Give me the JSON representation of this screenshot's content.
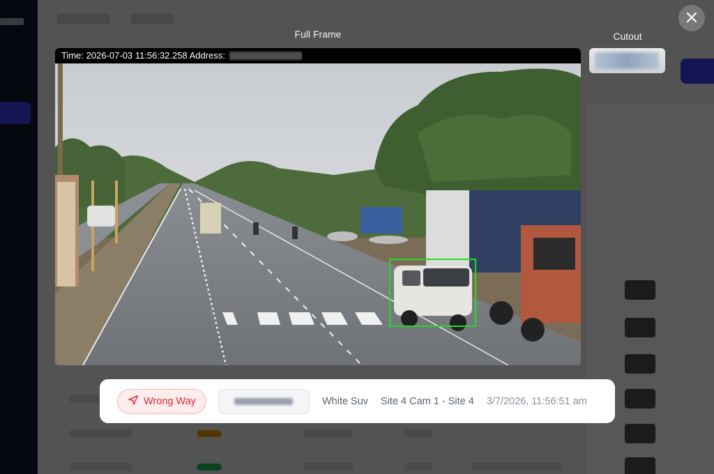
{
  "modal": {
    "full_frame_title": "Full Frame",
    "cutout_title": "Cutout",
    "frame_header": {
      "time_label": "Time:",
      "time_value": "2026-07-03 11:56:32.258",
      "address_label": "Address:"
    }
  },
  "event": {
    "violation_label": "Wrong Way",
    "vehicle": "White Suv",
    "camera": "Site 4 Cam 1 - Site 4",
    "timestamp": "3/7/2026, 11:56:51 am"
  },
  "icons": {
    "close": "close-icon",
    "violation": "navigation-arrow-icon"
  },
  "colors": {
    "bbox": "#22dd22",
    "violation_text": "#d92d3a",
    "violation_bg": "#fdecec",
    "accent": "#3b3ff0"
  }
}
